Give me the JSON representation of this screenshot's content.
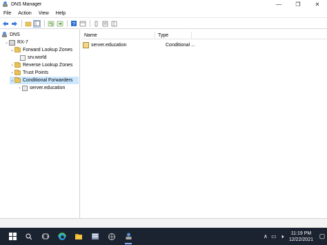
{
  "window": {
    "title": "DNS Manager",
    "minimize": "—",
    "restore": "❐",
    "close": "✕"
  },
  "menu": [
    "File",
    "Action",
    "View",
    "Help"
  ],
  "toolbar": {
    "buttons": [
      "back-arrow-icon",
      "forward-arrow-icon",
      "up-folder-icon",
      "show-hide-tree-icon",
      "refresh-icon",
      "export-list-icon",
      "help-icon",
      "properties-icon",
      "column-view-icon",
      "list-view-icon",
      "detail-view-icon"
    ]
  },
  "tree": {
    "root": "DNS",
    "server": "RX-7",
    "forward_zones": "Forward Lookup Zones",
    "forward_child": "srv.world",
    "reverse_zones": "Reverse Lookup Zones",
    "trust_points": "Trust Points",
    "conditional_forwarders": "Conditional Forwarders",
    "cf_child": "server.education"
  },
  "list": {
    "columns": [
      "Name",
      "Type"
    ],
    "rows": [
      {
        "name": "server.education",
        "type": "Conditional ..."
      }
    ]
  },
  "taskbar": {
    "clock_time": "11:19 PM",
    "clock_date": "12/22/2021",
    "tray_chevron": "∧"
  },
  "colors": {
    "selection": "#cce8ff",
    "taskbar": "#1c2330",
    "accent": "#5b8fd6"
  }
}
